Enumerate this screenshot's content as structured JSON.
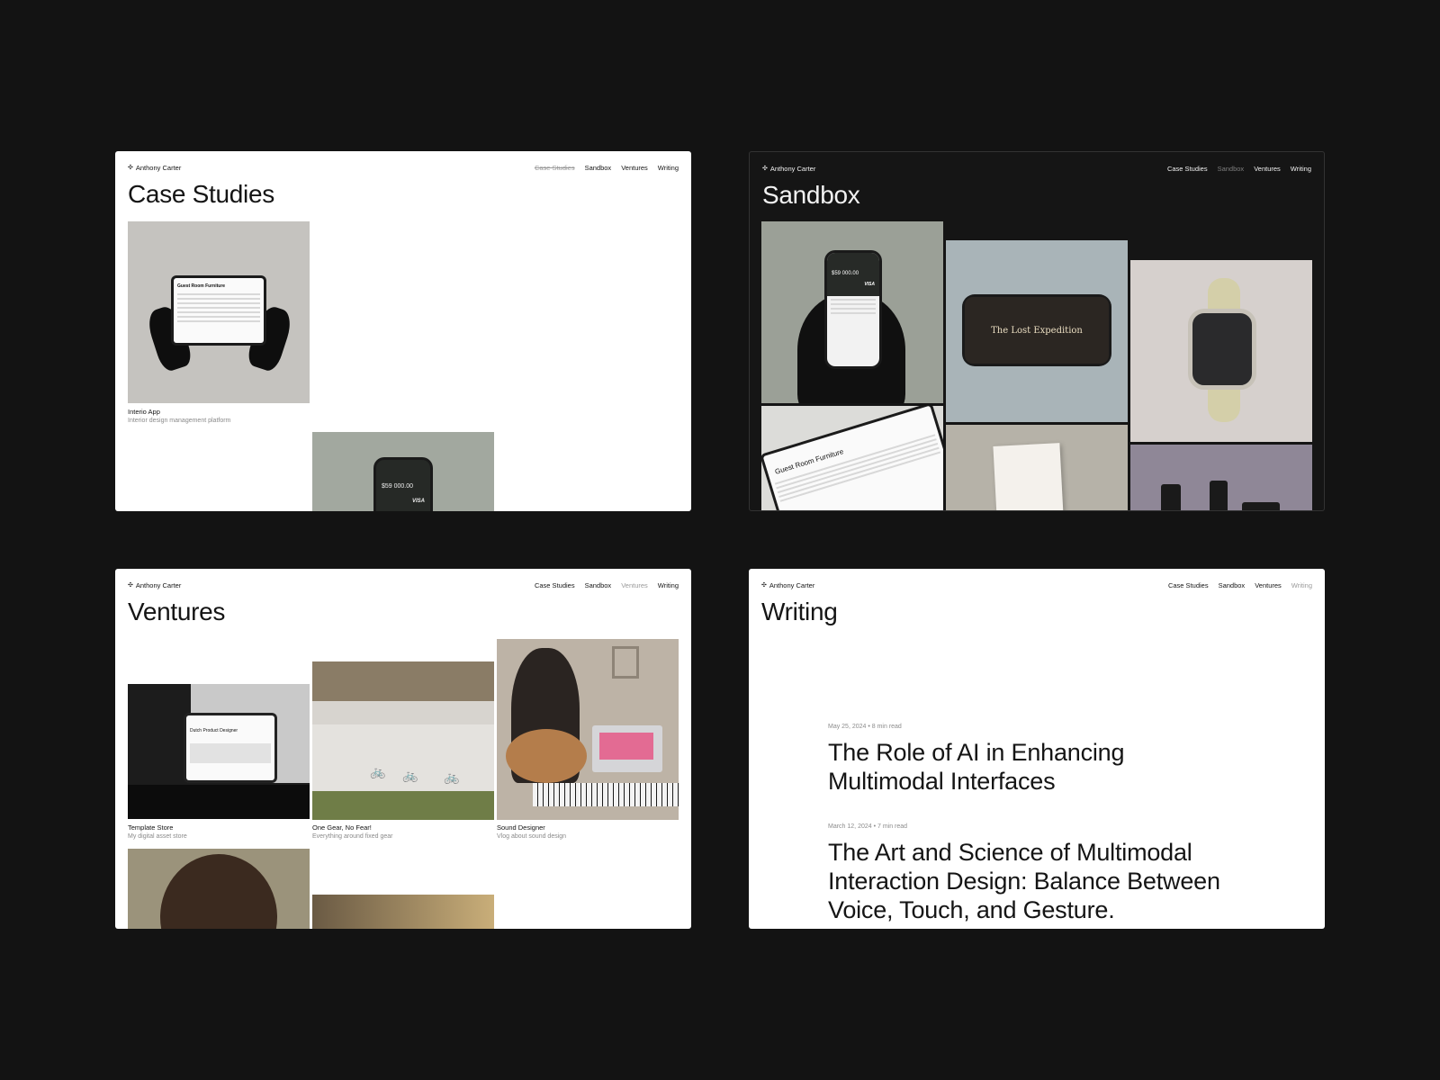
{
  "brand": "Anthony Carter",
  "brand_icon": "sparkle-icon",
  "nav": [
    "Case Studies",
    "Sandbox",
    "Ventures",
    "Writing"
  ],
  "colors": {
    "background": "#131313",
    "light_page": "#ffffff",
    "dark_page": "#151515",
    "muted": "#8a8a8a"
  },
  "case_studies": {
    "title": "Case Studies",
    "items": [
      {
        "title": "Interio App",
        "subtitle": "Interior design management platform",
        "screen_heading": "Guest Room Furniture"
      },
      {
        "screen_amount": "$59 000.00",
        "screen_brand": "VISA"
      }
    ]
  },
  "sandbox": {
    "title": "Sandbox",
    "phone_amount": "$59 000.00",
    "phone_brand": "VISA",
    "game_title": "The Lost Expedition",
    "tablet_heading": "Guest Room Furniture"
  },
  "ventures": {
    "title": "Ventures",
    "items": [
      {
        "title": "Template Store",
        "subtitle": "My digital asset store",
        "screen_heading": "Dutch Product Designer"
      },
      {
        "title": "One Gear, No Fear!",
        "subtitle": "Everything around fixed gear"
      },
      {
        "title": "Sound Designer",
        "subtitle": "Vlog about sound design"
      }
    ]
  },
  "writing": {
    "title": "Writing",
    "articles": [
      {
        "meta": "May 25, 2024  •  8 min read",
        "title": "The Role of AI in Enhancing Multimodal Interfaces"
      },
      {
        "meta": "March 12, 2024  •  7 min read",
        "title": "The Art and Science of Multimodal Interaction Design: Balance Between Voice, Touch, and Gesture."
      }
    ]
  }
}
